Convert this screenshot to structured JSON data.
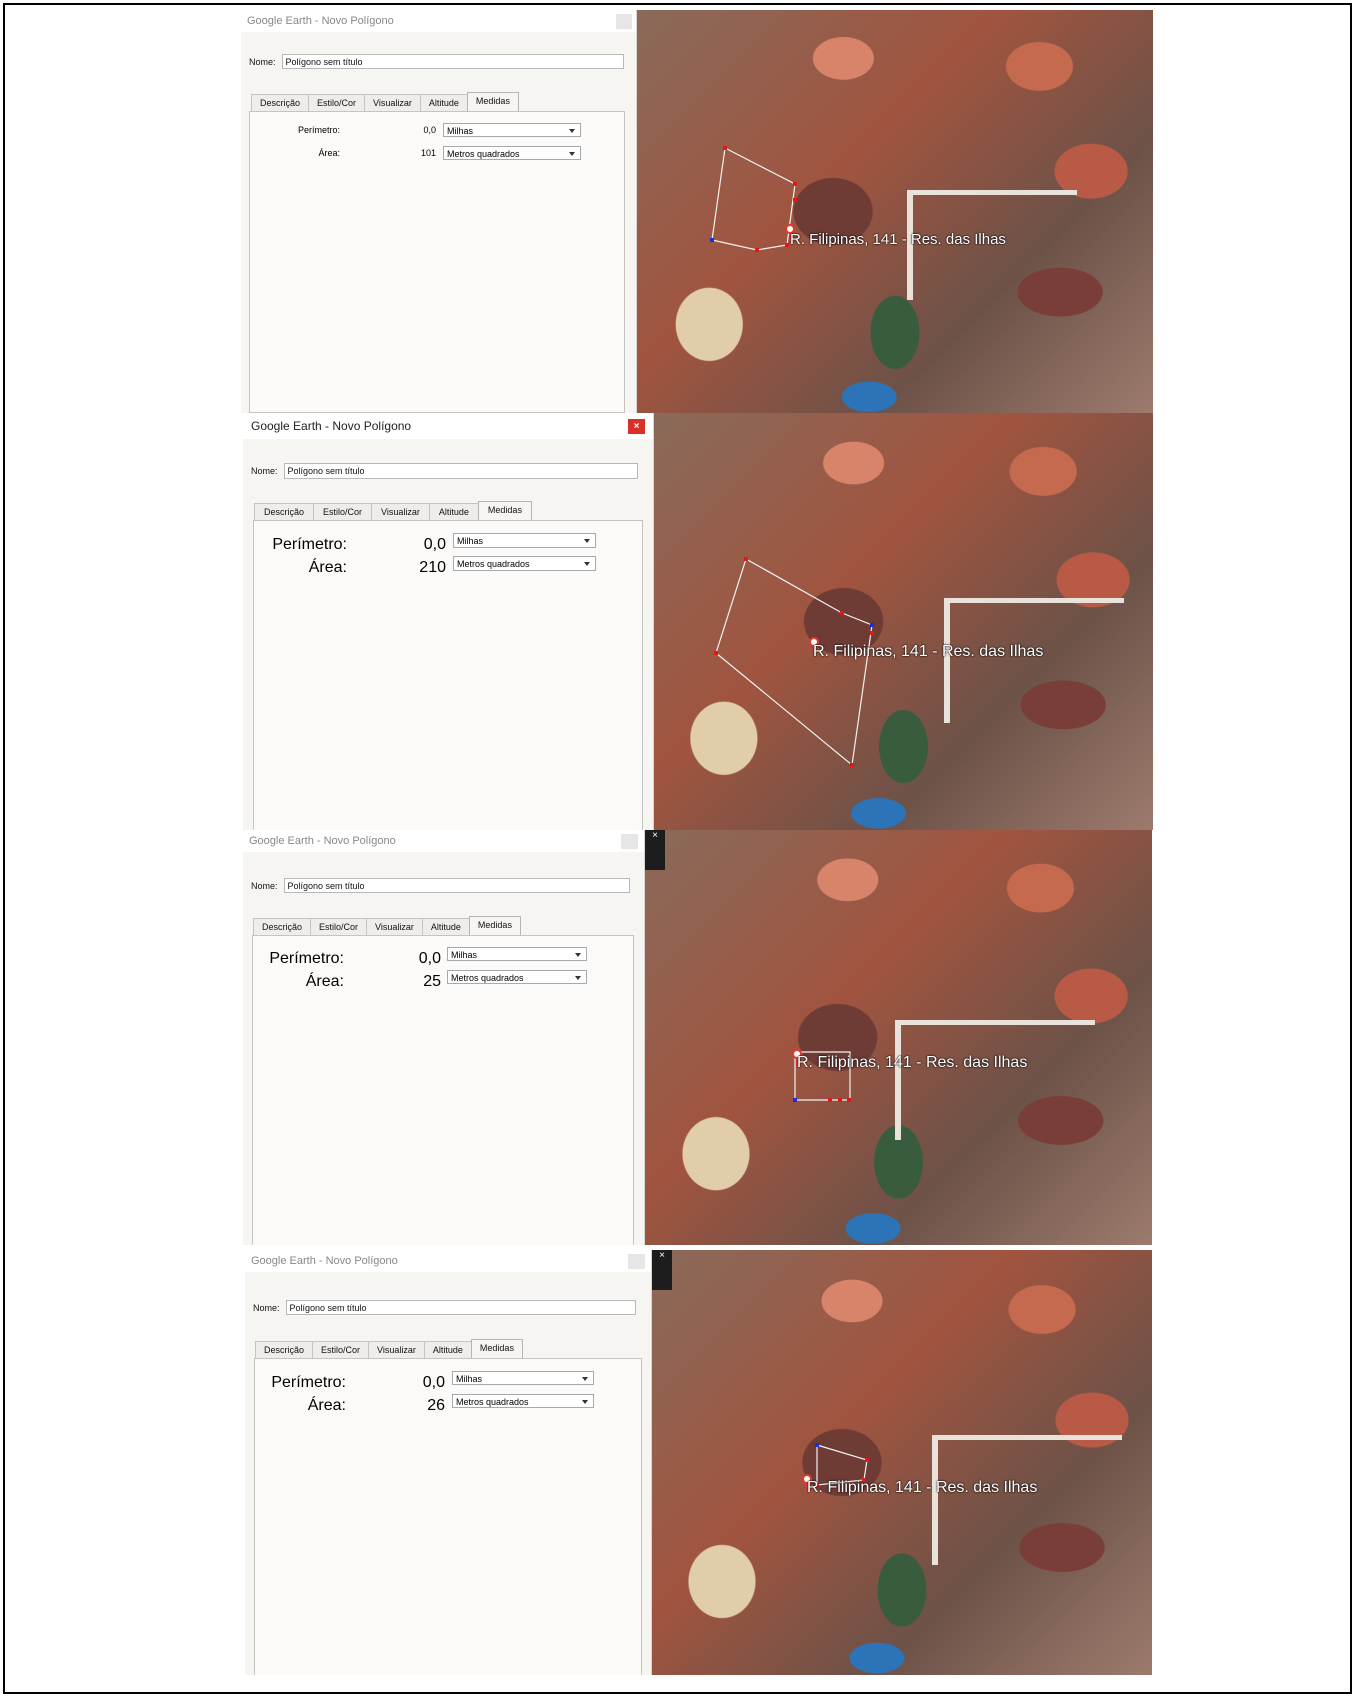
{
  "panels": [
    {
      "title": "Google Earth - Novo Polígono",
      "name_label": "Nome:",
      "name_value": "Polígono sem título",
      "tabs": [
        "Descrição",
        "Estilo/Cor",
        "Visualizar",
        "Altitude",
        "Medidas"
      ],
      "active_tab": "Medidas",
      "perimeter_label": "Perímetro:",
      "perimeter_value": "0,0",
      "perimeter_unit": "Milhas",
      "area_label": "Área:",
      "area_value": "101",
      "area_unit": "Metros quadrados",
      "address": "R. Filipinas, 141 - Res. das Ilhas"
    },
    {
      "title": "Google Earth - Novo Polígono",
      "close_icon": "×",
      "name_label": "Nome:",
      "name_value": "Polígono sem título",
      "tabs": [
        "Descrição",
        "Estilo/Cor",
        "Visualizar",
        "Altitude",
        "Medidas"
      ],
      "active_tab": "Medidas",
      "perimeter_label": "Perímetro:",
      "perimeter_value": "0,0",
      "perimeter_unit": "Milhas",
      "area_label": "Área:",
      "area_value": "210",
      "area_unit": "Metros quadrados",
      "address": "R. Filipinas, 141 - Res. das Ilhas"
    },
    {
      "title": "Google Earth - Novo Polígono",
      "map_close_icon": "×",
      "name_label": "Nome:",
      "name_value": "Polígono sem título",
      "tabs": [
        "Descrição",
        "Estilo/Cor",
        "Visualizar",
        "Altitude",
        "Medidas"
      ],
      "active_tab": "Medidas",
      "perimeter_label": "Perímetro:",
      "perimeter_value": "0,0",
      "perimeter_unit": "Milhas",
      "area_label": "Área:",
      "area_value": "25",
      "area_unit": "Metros quadrados",
      "address": "R. Filipinas, 141 - Res. das Ilhas"
    },
    {
      "title": "Google Earth - Novo Polígono",
      "map_close_icon": "×",
      "name_label": "Nome:",
      "name_value": "Polígono sem título",
      "tabs": [
        "Descrição",
        "Estilo/Cor",
        "Visualizar",
        "Altitude",
        "Medidas"
      ],
      "active_tab": "Medidas",
      "perimeter_label": "Perímetro:",
      "perimeter_value": "0,0",
      "perimeter_unit": "Milhas",
      "area_label": "Área:",
      "area_value": "26",
      "area_unit": "Metros quadrados",
      "address": "R. Filipinas, 141 - Res. das Ilhas"
    }
  ],
  "colors": {
    "vertex_red": "#e01818",
    "vertex_blue": "#1a2ee0",
    "edge_white": "#f2f2f2",
    "close_red": "#d9312a"
  }
}
